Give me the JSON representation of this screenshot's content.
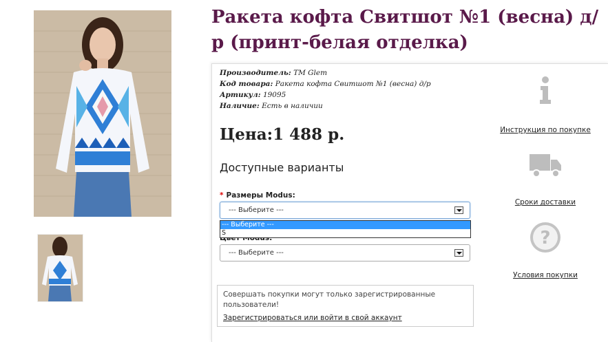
{
  "product": {
    "title": "Ракета кофта Свитшот №1 (весна) д/р (принт-белая отделка)",
    "manufacturer_label": "Производитель:",
    "manufacturer_value": "TM Glem",
    "code_label": "Код товара:",
    "code_value": "Ракета кофта Свитшот №1 (весна) д/р",
    "article_label": "Артикул:",
    "article_value": "19095",
    "stock_label": "Наличие:",
    "stock_value": "Есть в наличии",
    "price": "Цена:1 488 р."
  },
  "options": {
    "heading": "Доступные варианты",
    "size_label": "Размеры Modus:",
    "size_required": "*",
    "size_value": "--- Выберите ---",
    "size_dropdown": [
      "--- Выберите ---",
      "S"
    ],
    "color_label": "Цвет Modus:",
    "color_value": "--- Выберите ---"
  },
  "notice": {
    "text": "Совершать покупки могут только зарегистрированные пользователи!",
    "link": "Зарегистрироваться или войти в свой аккаунт"
  },
  "sidebar": {
    "instructions": "Инструкция по покупке",
    "delivery": "Сроки доставки",
    "terms": "Условия покупки"
  }
}
